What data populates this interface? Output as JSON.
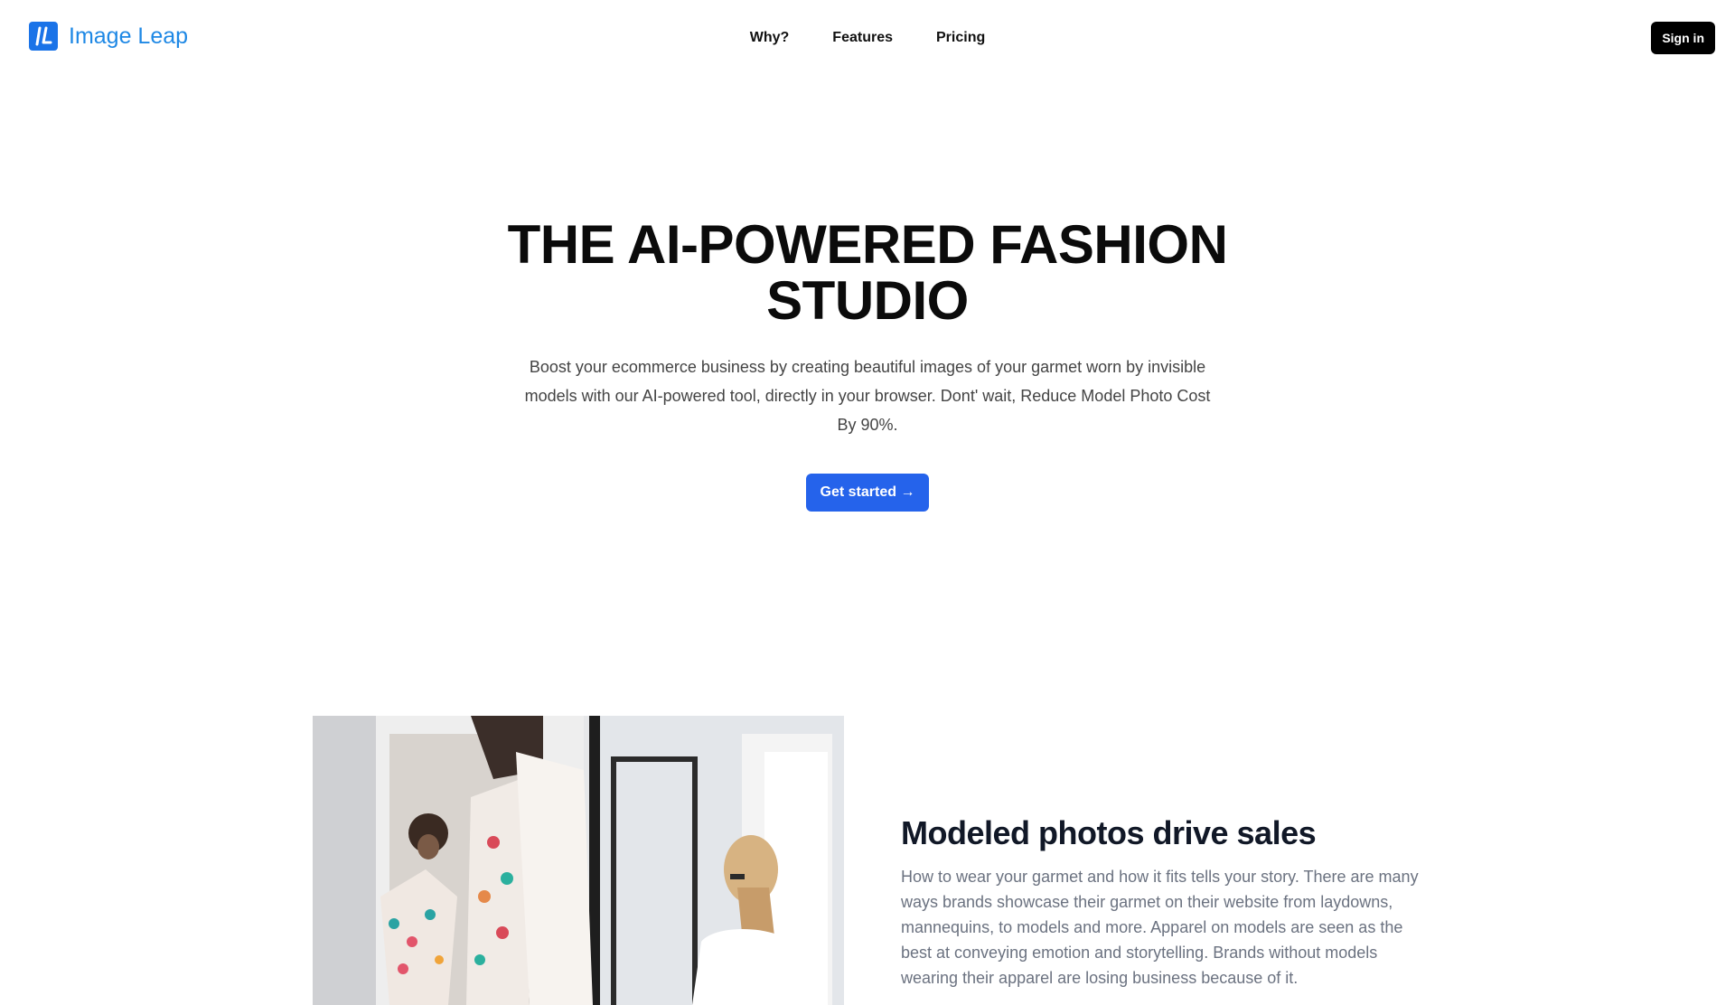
{
  "header": {
    "brand_name": "Image Leap",
    "nav": [
      "Why?",
      "Features",
      "Pricing"
    ],
    "sign_in_label": "Sign in"
  },
  "hero": {
    "title": "THE AI-POWERED FASHION STUDIO",
    "subtitle": "Boost your ecommerce business by creating beautiful images of your garmet worn by invisible models with our AI-powered tool, directly in your browser. Dont' wait, Reduce Model Photo Cost By 90%.",
    "cta_label": "Get started →"
  },
  "feature": {
    "title": "Modeled photos drive sales",
    "body": "How to wear your garmet and how it fits tells your story. There are many ways brands showcase their garmet on their website from laydowns, mannequins, to models and more. Apparel on models are seen as the best at conveying emotion and storytelling. Brands without models wearing their apparel are losing business because of it."
  },
  "colors": {
    "brand_blue": "#1e88e5",
    "logo_bg": "#1a73e8",
    "cta_blue": "#2563eb",
    "sign_in_bg": "#000000"
  },
  "icons": {
    "logo": "image-leap-logo-icon",
    "photo": "fashion-models-mirror-photo"
  }
}
